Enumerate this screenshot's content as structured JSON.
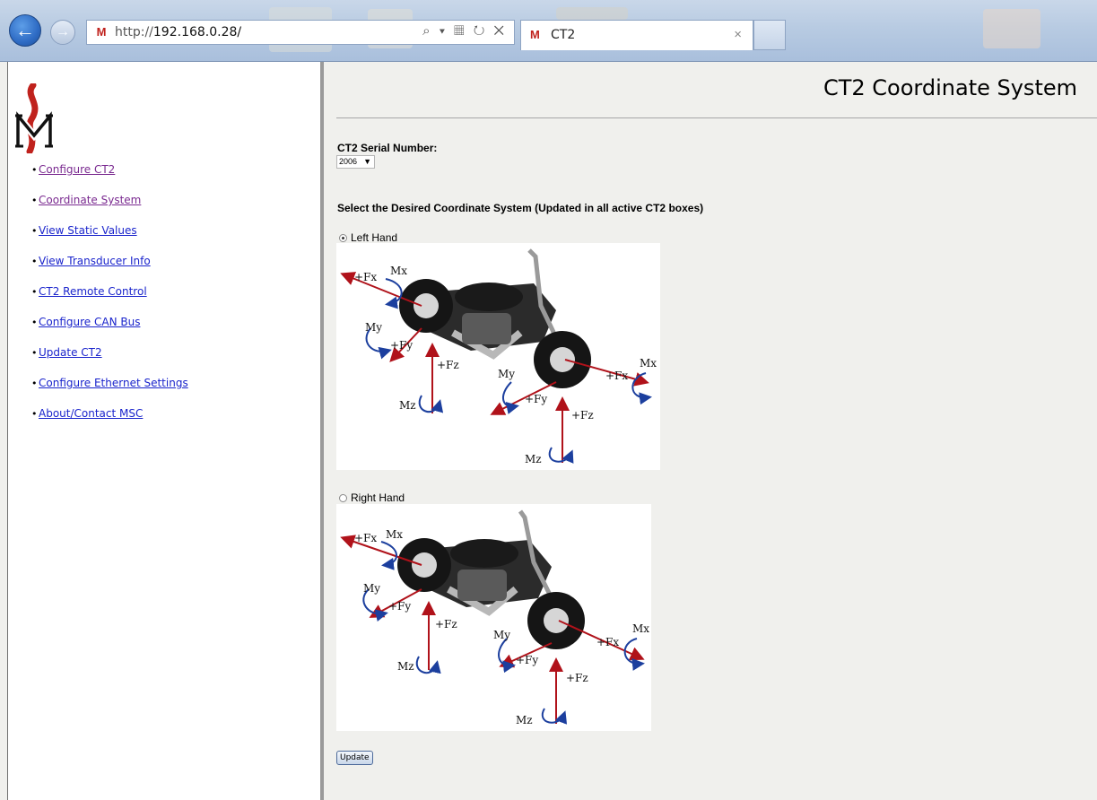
{
  "browser": {
    "url_prefix": "http://",
    "url_host": "192.168.0.28/",
    "address_icons": "⌕ ▾ ▦ ↻ ✕",
    "tab_title": "CT2",
    "tab_close": "×",
    "back_glyph": "←",
    "forward_glyph": "→"
  },
  "sidebar": {
    "logo_icon": "msc-logo-icon",
    "bullet": "•",
    "items": [
      {
        "label": "Configure CT2",
        "visited": true
      },
      {
        "label": "Coordinate System",
        "visited": true
      },
      {
        "label": "View Static Values",
        "visited": false
      },
      {
        "label": "View Transducer Info",
        "visited": false
      },
      {
        "label": "CT2 Remote Control",
        "visited": false
      },
      {
        "label": "Configure CAN Bus",
        "visited": false
      },
      {
        "label": "Update CT2",
        "visited": false
      },
      {
        "label": "Configure Ethernet Settings",
        "visited": false
      },
      {
        "label": "About/Contact MSC",
        "visited": false
      }
    ]
  },
  "main": {
    "title": "CT2 Coordinate System",
    "serial_label": "CT2 Serial Number:",
    "serial_value": "2006",
    "instruction": "Select the Desired Coordinate System (Updated in all active CT2 boxes)",
    "options": [
      {
        "label": "Left Hand",
        "selected": true
      },
      {
        "label": "Right Hand",
        "selected": false
      }
    ],
    "diagram_labels": {
      "fx": "+Fx",
      "fy": "+Fy",
      "fz": "+Fz",
      "mx": "Mx",
      "my": "My",
      "mz": "Mz"
    },
    "update_label": "Update"
  },
  "colors": {
    "link": "#1a24cc",
    "visited_link": "#7a2a90",
    "arrow_red": "#b0121a",
    "moment_blue": "#1c3f9e",
    "logo_red": "#c0221d"
  }
}
